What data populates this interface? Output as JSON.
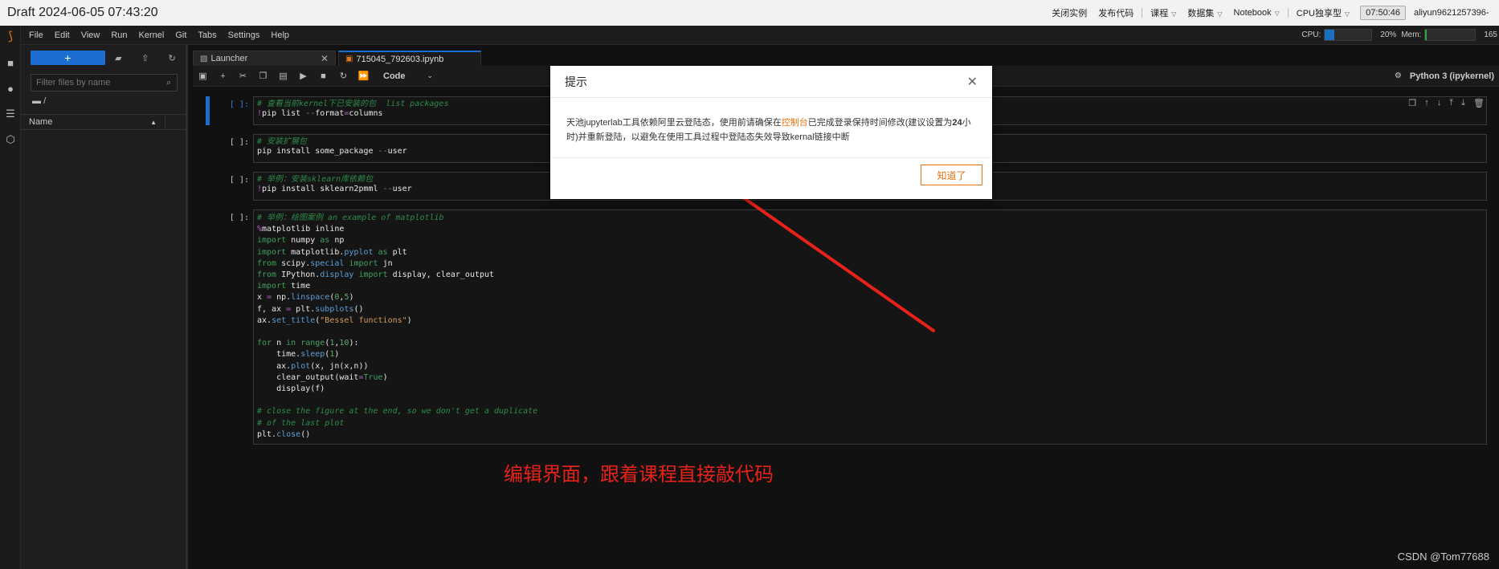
{
  "top_bar": {
    "title": "Draft 2024-06-05 07:43:20",
    "links": [
      "关闭实例",
      "发布代码"
    ],
    "dropdowns": [
      "课程",
      "数据集",
      "Notebook",
      "CPU独享型"
    ],
    "clock": "07:50:46",
    "user": "aliyun9621257396-"
  },
  "menu": {
    "items": [
      "File",
      "Edit",
      "View",
      "Run",
      "Kernel",
      "Git",
      "Tabs",
      "Settings",
      "Help"
    ],
    "cpu_label": "CPU:",
    "cpu_percent": "20%",
    "cpu_fill": 0.2,
    "mem_label": "Mem:",
    "mem_value": "165"
  },
  "file_browser": {
    "new_label": "+",
    "filter_placeholder": "Filter files by name",
    "path": "/",
    "column_name": "Name"
  },
  "tabs": [
    {
      "label": "Launcher"
    },
    {
      "label": "715045_792603.ipynb"
    }
  ],
  "toolbar": {
    "cell_type": "Code",
    "kernel": "Python 3 (ipykernel)"
  },
  "cells": [
    {
      "prompt": "[ ]:"
    },
    {
      "prompt": "[ ]:"
    },
    {
      "prompt": "[ ]:"
    },
    {
      "prompt": "[ ]:"
    }
  ],
  "modal": {
    "title": "提示",
    "body_before": "天池jupyterlab工具依赖阿里云登陆态，使用前请确保在",
    "body_link": "控制台",
    "body_after": "已完成登录保持时间修改(建议设置为",
    "body_bold": "24",
    "body_rest": "小时)并重新登陆，以避免在使用工具过程中登陆态失效导致kernal链接中断",
    "ok_label": "知道了"
  },
  "annotation": "编辑界面，跟着课程直接敲代码",
  "watermark": "CSDN @Tom77688",
  "colors": {
    "accent": "#1c6fd0",
    "orange": "#e67412",
    "annotation_red": "#e8221a"
  }
}
